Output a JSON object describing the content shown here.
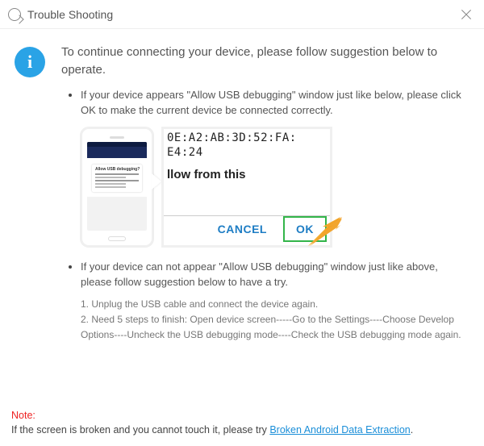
{
  "titlebar": {
    "title": "Trouble Shooting"
  },
  "lead": "To continue connecting your device, please follow suggestion below to operate.",
  "tip1": "If your device appears \"Allow USB debugging\" window just like below, please click OK to make the current device  be connected correctly.",
  "phone_dialog_title": "Allow USB debugging?",
  "zoom": {
    "mac_line1": "0E:A2:AB:3D:52:FA:",
    "mac_line2": "E4:24",
    "prompt": "llow from this",
    "cancel": "CANCEL",
    "ok": "OK"
  },
  "tip2": "If your device can not appear \"Allow USB debugging\" window just like above, please follow suggestion below to have a try.",
  "step1": "1. Unplug the USB cable and connect the device again.",
  "step2": "2. Need 5 steps to finish: Open device screen-----Go to the Settings----Choose Develop Options----Uncheck the USB debugging mode----Check the USB debugging mode again.",
  "note": {
    "label": "Note:",
    "text_before": "If the screen is broken and you cannot touch it, please try ",
    "link": "Broken Android Data Extraction",
    "text_after": "."
  }
}
